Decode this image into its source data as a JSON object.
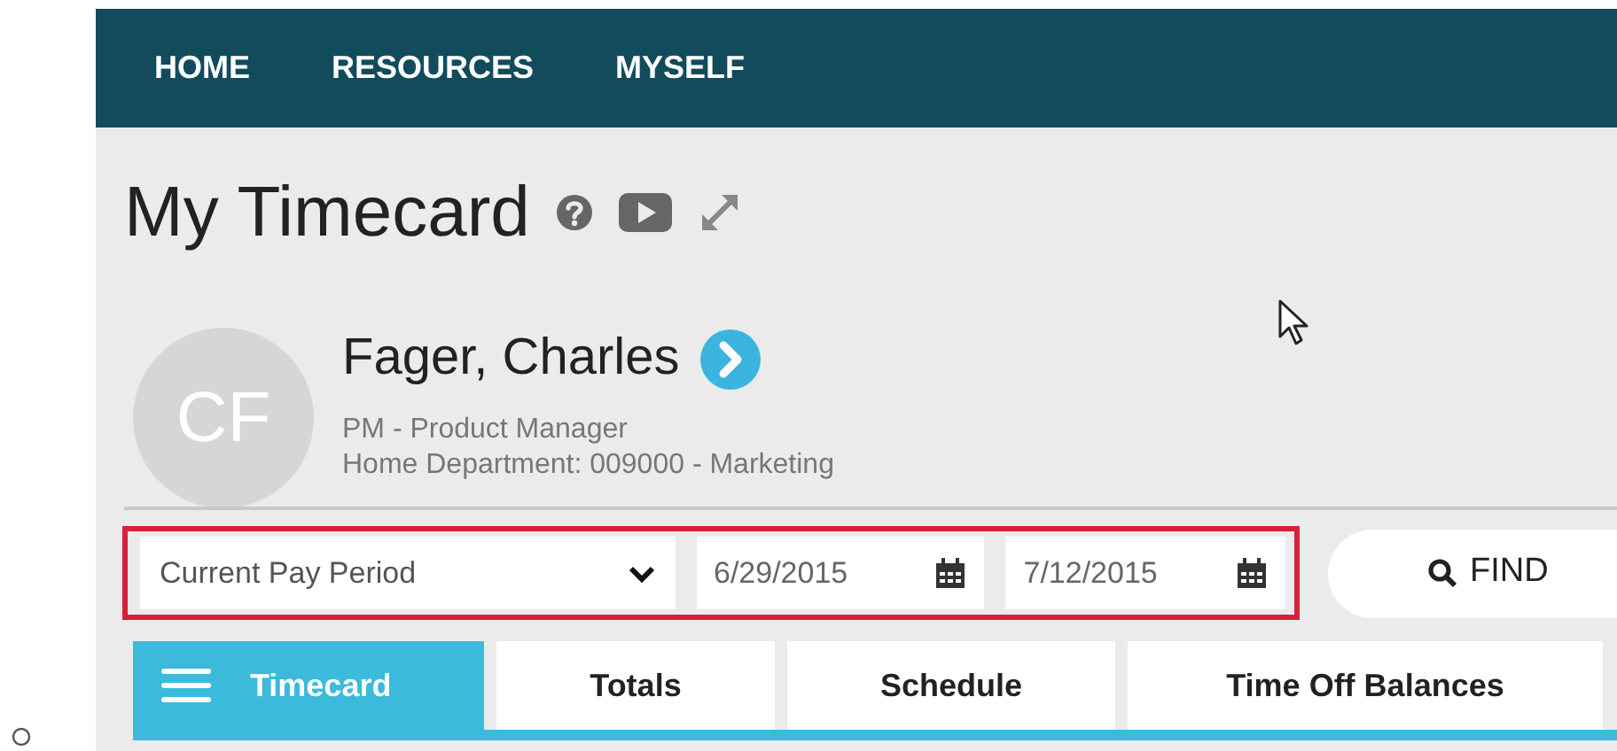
{
  "nav": {
    "items": [
      {
        "label": "HOME"
      },
      {
        "label": "RESOURCES"
      },
      {
        "label": "MYSELF"
      }
    ]
  },
  "page": {
    "title": "My Timecard"
  },
  "employee": {
    "initials": "CF",
    "name": "Fager, Charles",
    "position": "PM - Product Manager",
    "department": "Home Department: 009000 - Marketing"
  },
  "filters": {
    "period": "Current Pay Period",
    "start_date": "6/29/2015",
    "end_date": "7/12/2015",
    "find_button": "FIND"
  },
  "tabs": [
    {
      "label": "Timecard",
      "selected": true
    },
    {
      "label": "Totals",
      "selected": false
    },
    {
      "label": "Schedule",
      "selected": false
    },
    {
      "label": "Time Off Balances",
      "selected": false
    }
  ]
}
